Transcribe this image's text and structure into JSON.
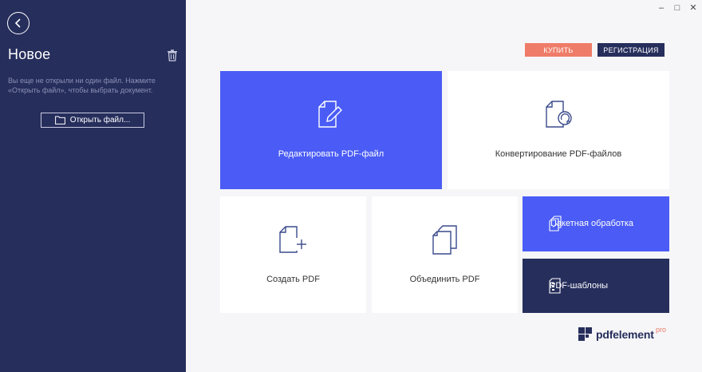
{
  "sidebar": {
    "title": "Новое",
    "hint": "Вы еще не открыли ни один файл. Нажмите «Открыть файл», чтобы выбрать документ.",
    "open_button": "Открыть файл...",
    "back_icon": "back-arrow-icon",
    "delete_icon": "trash-icon"
  },
  "window": {
    "minimize": "–",
    "maximize": "□",
    "close": "✕"
  },
  "header": {
    "buy_label": "КУПИТЬ",
    "register_label": "РЕГИСТРАЦИЯ"
  },
  "tiles": {
    "edit": "Редактировать PDF-файл",
    "convert": "Конвертирование PDF-файлов",
    "create": "Создать PDF",
    "merge": "Объединить PDF",
    "batch": "Пакетная обработка",
    "templates": "PDF-шаблоны"
  },
  "brand": {
    "name": "pdfelement",
    "edition": "pro"
  },
  "colors": {
    "sidebar": "#262e5c",
    "accent_blue": "#4a5cf5",
    "buy": "#ef7c68",
    "background": "#f6f6f8"
  }
}
